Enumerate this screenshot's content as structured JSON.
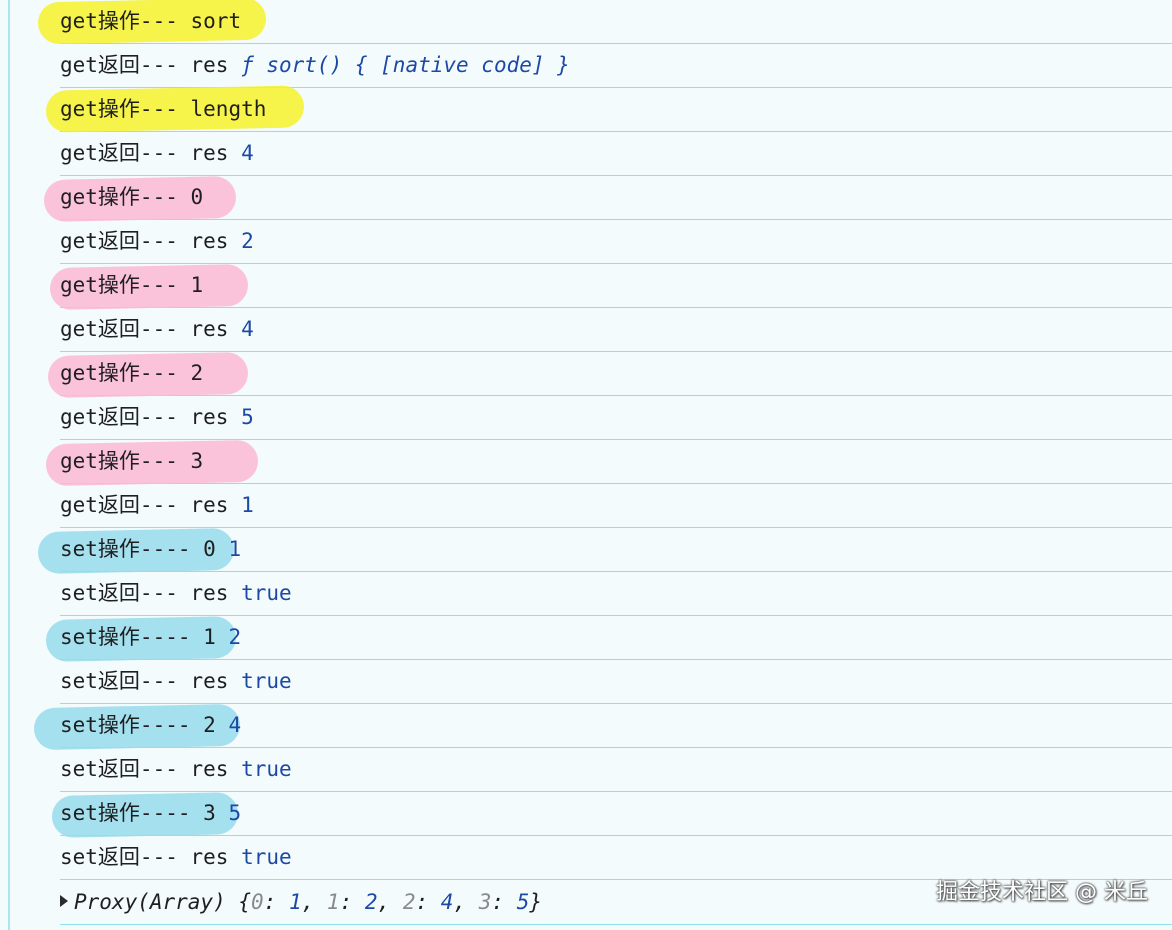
{
  "console": {
    "rows": [
      {
        "prefix": "get操作--- ",
        "value": "sort",
        "highlight": "yellow"
      },
      {
        "prefix": "get返回--- res ",
        "value": "ƒ sort() { [native code] }"
      },
      {
        "prefix": "get操作--- ",
        "value": "length",
        "highlight": "yellow"
      },
      {
        "prefix": "get返回--- res ",
        "value": "4"
      },
      {
        "prefix": "get操作--- ",
        "value": "0",
        "highlight": "pink"
      },
      {
        "prefix": "get返回--- res ",
        "value": "2"
      },
      {
        "prefix": "get操作--- ",
        "value": "1",
        "highlight": "pink"
      },
      {
        "prefix": "get返回--- res ",
        "value": "4"
      },
      {
        "prefix": "get操作--- ",
        "value": "2",
        "highlight": "pink"
      },
      {
        "prefix": "get返回--- res ",
        "value": "5"
      },
      {
        "prefix": "get操作--- ",
        "value": "3",
        "highlight": "pink"
      },
      {
        "prefix": "get返回--- res ",
        "value": "1"
      },
      {
        "prefix": "set操作---- 0 ",
        "value": "1",
        "highlight": "cyan"
      },
      {
        "prefix": "set返回--- res ",
        "value": "true"
      },
      {
        "prefix": "set操作---- 1 ",
        "value": "2",
        "highlight": "cyan"
      },
      {
        "prefix": "set返回--- res ",
        "value": "true"
      },
      {
        "prefix": "set操作---- 2 ",
        "value": "4",
        "highlight": "cyan"
      },
      {
        "prefix": "set返回--- res ",
        "value": "true"
      },
      {
        "prefix": "set操作---- 3 ",
        "value": "5",
        "highlight": "cyan"
      },
      {
        "prefix": "set返回--- res ",
        "value": "true"
      }
    ],
    "proxy": {
      "label": "Proxy(Array) {",
      "entries": [
        {
          "key": "0",
          "value": "1"
        },
        {
          "key": "1",
          "value": "2"
        },
        {
          "key": "2",
          "value": "4"
        },
        {
          "key": "3",
          "value": "5"
        }
      ],
      "close": "}"
    }
  },
  "watermark": "掘金技术社区 @ 米丘",
  "colors": {
    "yellow_highlight": "#f6f12a",
    "pink_highlight": "#fab9d4",
    "cyan_highlight": "#96daec",
    "value_blue": "#1d49a6",
    "row_divider": "#8fe0ea",
    "background": "#f3fbfc"
  }
}
